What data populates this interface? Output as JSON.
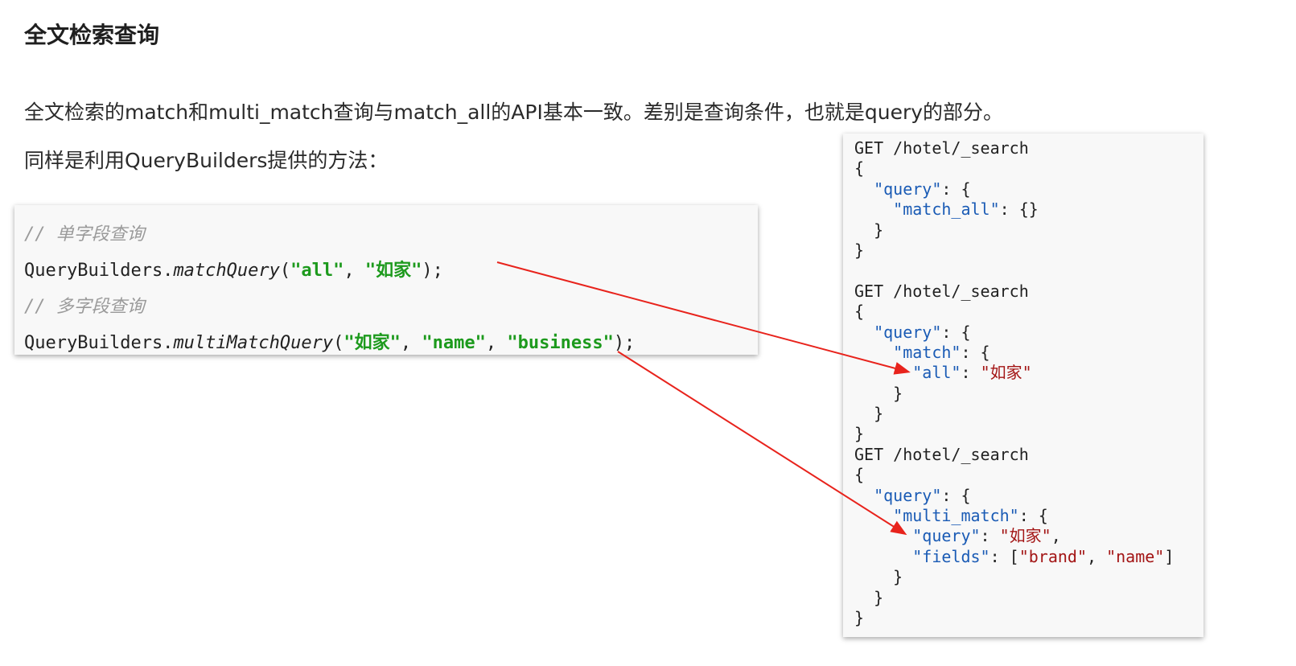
{
  "heading": "全文检索查询",
  "paragraph1": "全文检索的match和multi_match查询与match_all的API基本一致。差别是查询条件，也就是query的部分。",
  "paragraph2": "同样是利用QueryBuilders提供的方法：",
  "left_code": {
    "comment1": "// 单字段查询",
    "line2": {
      "prefix": "QueryBuilders.",
      "method": "matchQuery",
      "open": "(",
      "arg1": "\"all\"",
      "sep": ", ",
      "arg2": "\"如家\"",
      "close": ");"
    },
    "comment2": "// 多字段查询",
    "line4": {
      "prefix": "QueryBuilders.",
      "method": "multiMatchQuery",
      "open": "(",
      "arg1": "\"如家\"",
      "sep1": ", ",
      "arg2": "\"name\"",
      "sep2": ", ",
      "arg3": "\"business\"",
      "close": ");"
    }
  },
  "right_code": {
    "block1": {
      "request": "GET /hotel/_search",
      "open": "{",
      "query_key": "\"query\"",
      "match_all_key": "\"match_all\"",
      "match_all_val": "{}"
    },
    "block2": {
      "request": "GET /hotel/_search",
      "query_key": "\"query\"",
      "match_key": "\"match\"",
      "all_key": "\"all\"",
      "all_val": "\"如家\""
    },
    "block3": {
      "request": "GET /hotel/_search",
      "query_key": "\"query\"",
      "multi_match_key": "\"multi_match\"",
      "inner_query_key": "\"query\"",
      "inner_query_val": "\"如家\"",
      "fields_key": "\"fields\"",
      "field1": "\"brand\"",
      "field2": "\"name\""
    }
  },
  "colors": {
    "string_green": "#1d9a1d",
    "json_key": "#1a5bb5",
    "json_string": "#a31515",
    "arrow": "#e8231c",
    "comment": "#9a9a9a"
  }
}
